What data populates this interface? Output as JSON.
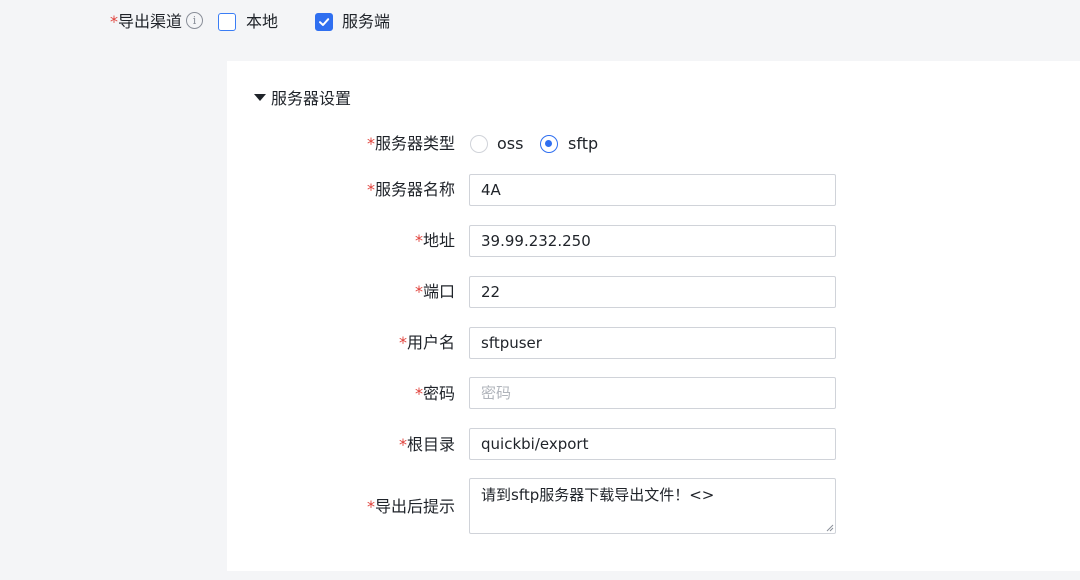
{
  "export_channel": {
    "required_mark": "*",
    "label": "导出渠道",
    "info_icon": "info-icon",
    "options": [
      {
        "label": "本地",
        "checked": false
      },
      {
        "label": "服务端",
        "checked": true
      }
    ]
  },
  "server_settings": {
    "title": "服务器设置",
    "expanded": true,
    "server_type": {
      "required_mark": "*",
      "label": "服务器类型",
      "options": [
        {
          "label": "oss",
          "selected": false
        },
        {
          "label": "sftp",
          "selected": true
        }
      ]
    },
    "fields": {
      "server_name": {
        "required_mark": "*",
        "label": "服务器名称",
        "value": "4A"
      },
      "address": {
        "required_mark": "*",
        "label": "地址",
        "value": "39.99.232.250"
      },
      "port": {
        "required_mark": "*",
        "label": "端口",
        "value": "22"
      },
      "username": {
        "required_mark": "*",
        "label": "用户名",
        "value": "sftpuser"
      },
      "password": {
        "required_mark": "*",
        "label": "密码",
        "value": "",
        "placeholder": "密码"
      },
      "root_dir": {
        "required_mark": "*",
        "label": "根目录",
        "value": "quickbi/export"
      },
      "post_export_hint": {
        "required_mark": "*",
        "label": "导出后提示",
        "value": "请到sftp服务器下载导出文件！<>"
      }
    }
  },
  "colors": {
    "primary": "#2f6ff0",
    "required": "#e0413a",
    "border": "#d0d3d9",
    "page_bg": "#f4f5f7",
    "panel_bg": "#ffffff"
  }
}
